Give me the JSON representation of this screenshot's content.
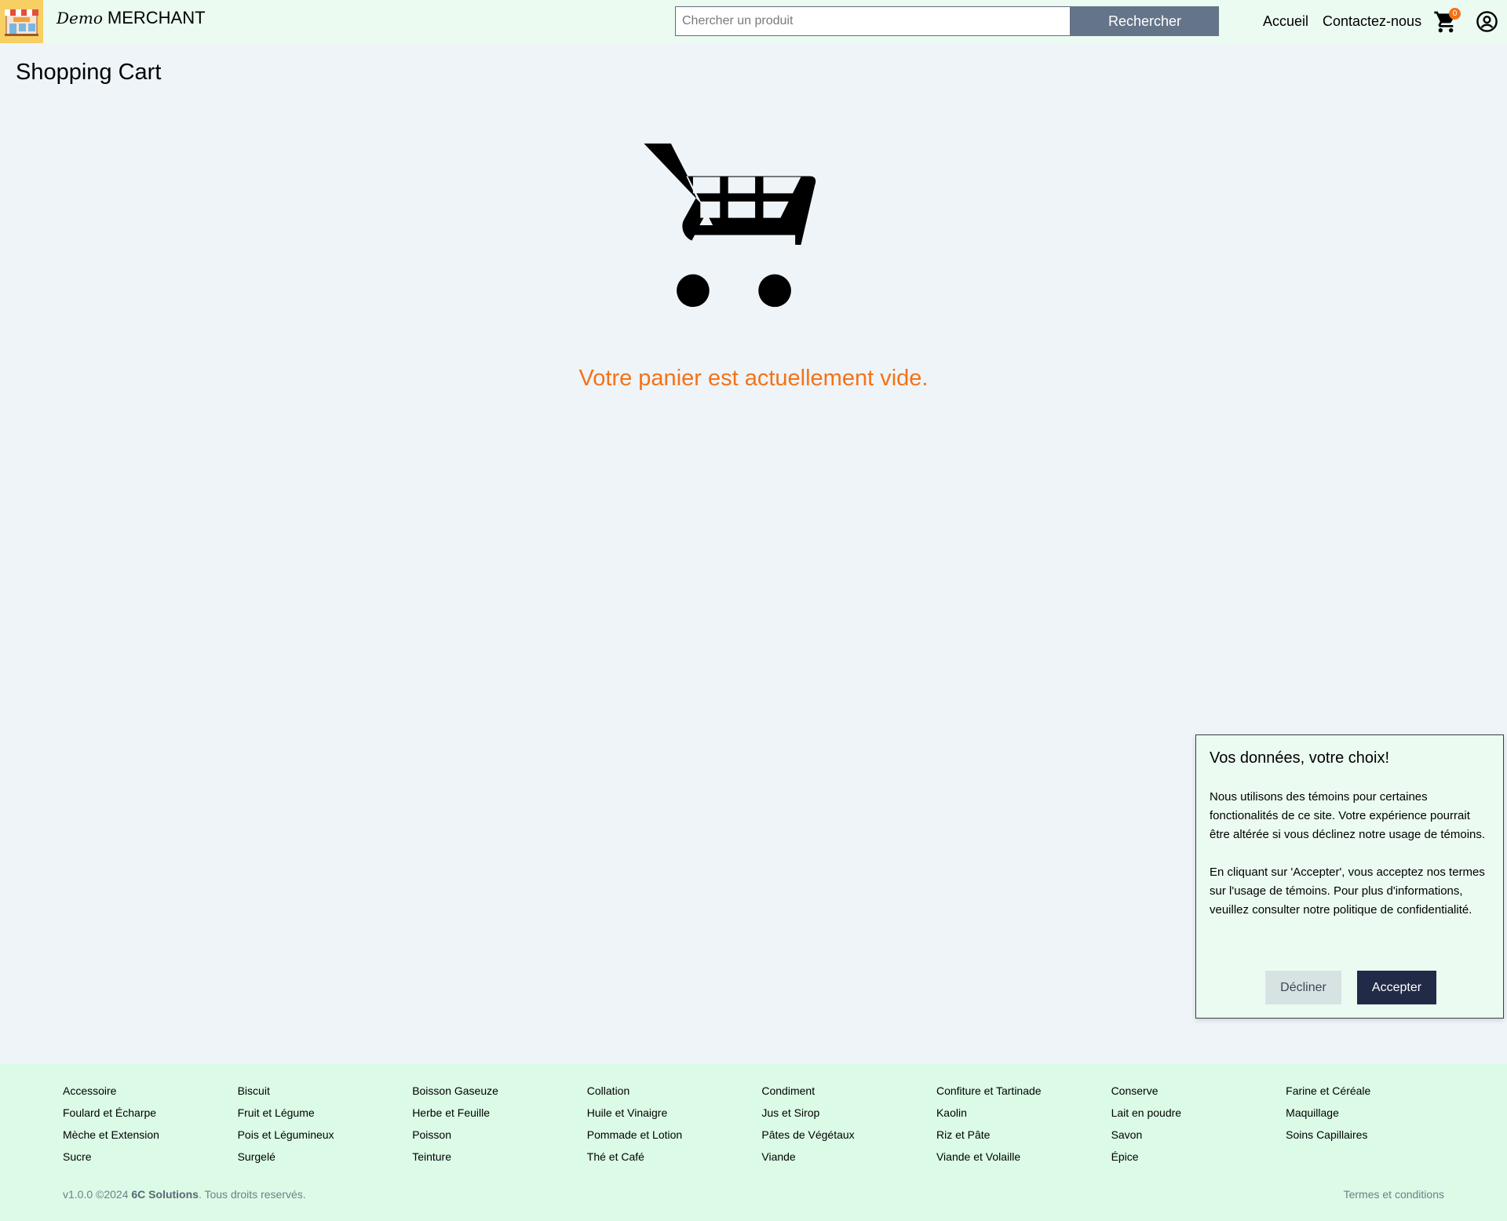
{
  "header": {
    "brand_script": "Demo",
    "brand_name": "MERCHANT",
    "search_placeholder": "Chercher un produit",
    "search_button": "Rechercher",
    "nav_home": "Accueil",
    "nav_contact": "Contactez-nous",
    "cart_count": "0"
  },
  "main": {
    "title": "Shopping Cart",
    "empty_message": "Votre panier est actuellement vide."
  },
  "cookie": {
    "title": "Vos données, votre choix!",
    "paragraph1": "Nous utilisons des témoins pour certaines fonctionalités de ce site. Votre expérience pourrait être altérée si vous déclinez notre usage de témoins.",
    "paragraph2": "En cliquant sur 'Accepter', vous acceptez nos termes sur l'usage de témoins. Pour plus d'informations, veuillez consulter notre politique de confidentialité.",
    "decline": "Décliner",
    "accept": "Accepter"
  },
  "footer": {
    "categories": [
      "Accessoire",
      "Biscuit",
      "Boisson Gaseuze",
      "Collation",
      "Condiment",
      "Confiture et Tartinade",
      "Conserve",
      "Farine et Céréale",
      "Foulard et Écharpe",
      "Fruit et Légume",
      "Herbe et Feuille",
      "Huile et Vinaigre",
      "Jus et Sirop",
      "Kaolin",
      "Lait en poudre",
      "Maquillage",
      "Mèche et Extension",
      "Pois et Légumineux",
      "Poisson",
      "Pommade et Lotion",
      "Pâtes de Végétaux",
      "Riz et Pâte",
      "Savon",
      "Soins Capillaires",
      "Sucre",
      "Surgelé",
      "Teinture",
      "Thé et Café",
      "Viande",
      "Viande et Volaille",
      "Épice"
    ],
    "copyright_prefix": "v1.0.0 ©2024 ",
    "copyright_company": "6C Solutions",
    "copyright_suffix": ". Tous droits reservés.",
    "terms": "Termes et conditions"
  },
  "colors": {
    "accent_orange": "#f47216",
    "search_button": "#647489",
    "accept_button": "#212a46",
    "header_bg": "#ebfbf1",
    "footer_bg": "#dbfbe6"
  },
  "icons": [
    "store-logo-icon",
    "cart-icon",
    "user-circle-icon",
    "empty-cart-icon"
  ]
}
